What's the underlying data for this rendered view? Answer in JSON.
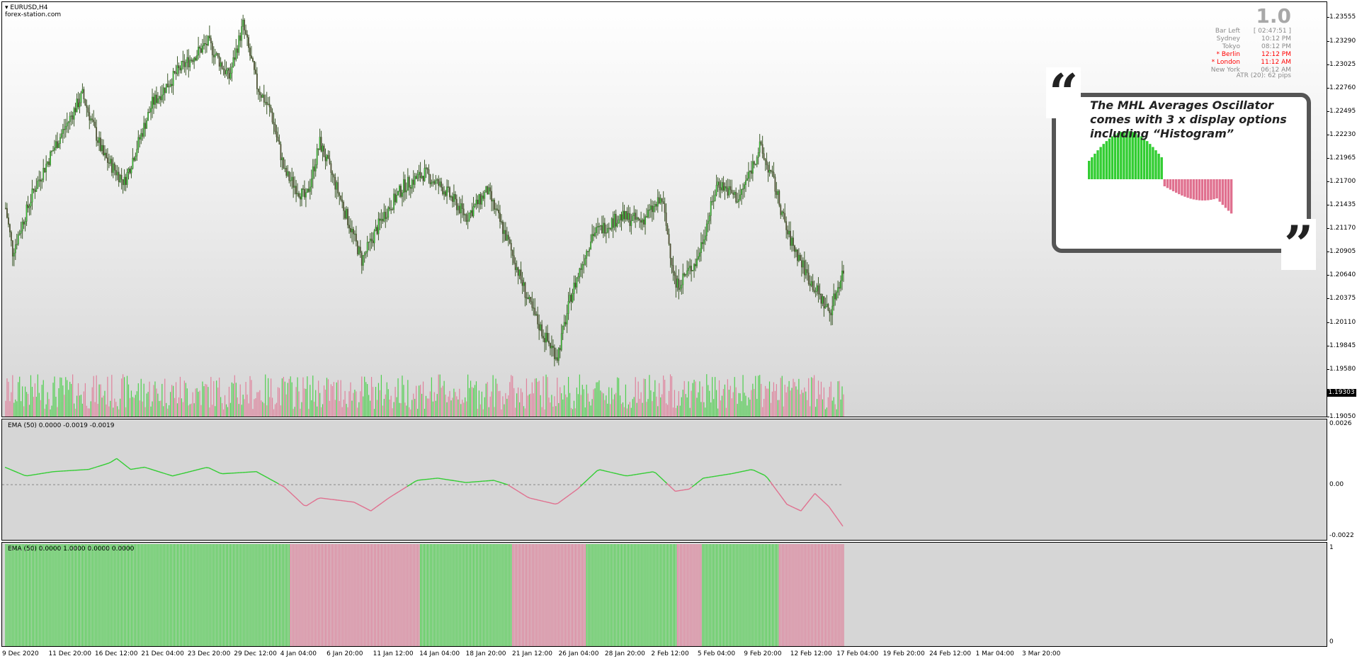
{
  "window": {
    "symbol": "EURUSD,H4",
    "site": "forex-station.com"
  },
  "info_panel": {
    "version": "1.0",
    "rows": [
      {
        "key": "Bar Left",
        "value": "[ 02:47:51 ]",
        "highlight": false
      },
      {
        "key": "Sydney",
        "value": "10:12 PM",
        "highlight": false
      },
      {
        "key": "Tokyo",
        "value": "08:12 PM",
        "highlight": false
      },
      {
        "key": "* Berlin",
        "value": "12:12 PM",
        "highlight": true
      },
      {
        "key": "* London",
        "value": "11:12 AM",
        "highlight": true
      },
      {
        "key": "New York",
        "value": "06:12 AM",
        "highlight": false
      }
    ],
    "atr": "ATR (20): 62 pips"
  },
  "callout": {
    "text": "The MHL Averages Oscillator comes with 3 x display options including “Histogram”",
    "quote_open": "“",
    "quote_close": "”"
  },
  "price_axis": {
    "labels": [
      "1.23555",
      "1.23290",
      "1.23025",
      "1.22760",
      "1.22495",
      "1.22230",
      "1.21965",
      "1.21700",
      "1.21435",
      "1.21170",
      "1.20905",
      "1.20640",
      "1.20375",
      "1.20110",
      "1.19845",
      "1.19580",
      "1.19050"
    ],
    "current_price": "1.19303"
  },
  "oscillator": {
    "label": "EMA (50) 0.0000 -0.0019 -0.0019",
    "axis_labels": [
      "0.0026",
      "0.00",
      "-0.0022"
    ]
  },
  "histogram": {
    "label": "EMA (50) 0.0000 1.0000 0.0000 0.0000",
    "axis_labels": [
      "1",
      "0"
    ]
  },
  "time_axis": {
    "labels": [
      "9 Dec 2020",
      "11 Dec 20:00",
      "16 Dec 12:00",
      "21 Dec 04:00",
      "23 Dec 20:00",
      "29 Dec 12:00",
      "4 Jan 04:00",
      "6 Jan 20:00",
      "11 Jan 12:00",
      "14 Jan 04:00",
      "18 Jan 20:00",
      "21 Jan 12:00",
      "26 Jan 04:00",
      "28 Jan 20:00",
      "2 Feb 12:00",
      "5 Feb 04:00",
      "9 Feb 20:00",
      "12 Feb 12:00",
      "17 Feb 04:00",
      "19 Feb 20:00",
      "24 Feb 12:00",
      "1 Mar 04:00",
      "3 Mar 20:00"
    ]
  },
  "colors": {
    "bull": "#32cd32",
    "bear": "#e0708f",
    "candle_wick": "#3c5a2a",
    "callout_border": "#555555"
  },
  "chart_data": {
    "type": "candlestick",
    "price_series_keypoints": [
      [
        0,
        1.214
      ],
      [
        5,
        1.209
      ],
      [
        20,
        1.216
      ],
      [
        35,
        1.221
      ],
      [
        55,
        1.227
      ],
      [
        70,
        1.22
      ],
      [
        85,
        1.217
      ],
      [
        105,
        1.226
      ],
      [
        125,
        1.23
      ],
      [
        145,
        1.233
      ],
      [
        160,
        1.229
      ],
      [
        170,
        1.235
      ],
      [
        180,
        1.228
      ],
      [
        190,
        1.225
      ],
      [
        200,
        1.218
      ],
      [
        215,
        1.215
      ],
      [
        225,
        1.2215
      ],
      [
        240,
        1.215
      ],
      [
        255,
        1.208
      ],
      [
        270,
        1.213
      ],
      [
        285,
        1.2165
      ],
      [
        300,
        1.218
      ],
      [
        315,
        1.216
      ],
      [
        330,
        1.213
      ],
      [
        345,
        1.216
      ],
      [
        360,
        1.21
      ],
      [
        375,
        1.203
      ],
      [
        385,
        1.1995
      ],
      [
        395,
        1.197
      ],
      [
        405,
        1.204
      ],
      [
        420,
        1.211
      ],
      [
        440,
        1.213
      ],
      [
        455,
        1.2125
      ],
      [
        470,
        1.215
      ],
      [
        480,
        1.205
      ],
      [
        495,
        1.208
      ],
      [
        510,
        1.217
      ],
      [
        525,
        1.215
      ],
      [
        540,
        1.221
      ],
      [
        550,
        1.217
      ],
      [
        560,
        1.211
      ],
      [
        575,
        1.206
      ],
      [
        590,
        1.202
      ],
      [
        600,
        1.207
      ]
    ],
    "price_range": [
      1.1905,
      1.236
    ],
    "oscillator_keypoints": [
      [
        0,
        0.0008
      ],
      [
        15,
        0.0004
      ],
      [
        35,
        0.0006
      ],
      [
        60,
        0.0007
      ],
      [
        75,
        0.001
      ],
      [
        80,
        0.0012
      ],
      [
        90,
        0.0007
      ],
      [
        100,
        0.0008
      ],
      [
        120,
        0.0004
      ],
      [
        145,
        0.0008
      ],
      [
        155,
        0.0005
      ],
      [
        180,
        0.0006
      ],
      [
        200,
        -0.0001
      ],
      [
        215,
        -0.001
      ],
      [
        225,
        -0.0006
      ],
      [
        250,
        -0.0008
      ],
      [
        262,
        -0.0012
      ],
      [
        275,
        -0.0006
      ],
      [
        295,
        0.0002
      ],
      [
        310,
        0.0003
      ],
      [
        330,
        0.0001
      ],
      [
        350,
        0.0002
      ],
      [
        360,
        0.0
      ],
      [
        375,
        -0.0006
      ],
      [
        395,
        -0.0009
      ],
      [
        410,
        -0.0002
      ],
      [
        425,
        0.0007
      ],
      [
        445,
        0.0004
      ],
      [
        465,
        0.0006
      ],
      [
        480,
        -0.0003
      ],
      [
        490,
        -0.0002
      ],
      [
        500,
        0.0003
      ],
      [
        520,
        0.0005
      ],
      [
        535,
        0.0007
      ],
      [
        545,
        0.0004
      ],
      [
        560,
        -0.0009
      ],
      [
        570,
        -0.0012
      ],
      [
        580,
        -0.0004
      ],
      [
        590,
        -0.001
      ],
      [
        600,
        -0.0019
      ]
    ],
    "oscillator_range": [
      -0.0022,
      0.0026
    ],
    "histogram_segments": [
      {
        "from": 0,
        "to": 204,
        "state": "bull"
      },
      {
        "from": 204,
        "to": 297,
        "state": "bear"
      },
      {
        "from": 297,
        "to": 363,
        "state": "bull"
      },
      {
        "from": 363,
        "to": 416,
        "state": "bear"
      },
      {
        "from": 416,
        "to": 481,
        "state": "bull"
      },
      {
        "from": 481,
        "to": 499,
        "state": "bear"
      },
      {
        "from": 499,
        "to": 554,
        "state": "bull"
      },
      {
        "from": 554,
        "to": 601,
        "state": "bear"
      }
    ],
    "bar_count": 601
  }
}
